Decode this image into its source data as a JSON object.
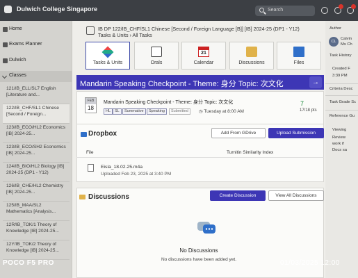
{
  "app": {
    "title": "Dulwich College Singapore"
  },
  "search": {
    "placeholder": "Search"
  },
  "sidebar": {
    "nav": [
      {
        "label": "Home",
        "icon": "home-icon"
      },
      {
        "label": "Exams Planner",
        "icon": "calendar-icon"
      },
      {
        "label": "Dulwich",
        "icon": "building-icon"
      }
    ],
    "classes_label": "Classes",
    "classes": [
      {
        "label": "121/IB_ELL/SL7 English [Literature and..."
      },
      {
        "label": "122/IB_CHF/SL1 Chinese [Second / Foreign..."
      },
      {
        "label": "123/IB_ECO/HL2 Economics [IB] 2024-25..."
      },
      {
        "label": "123/IB_ECO/SH2 Economics [IB] 2024-25..."
      },
      {
        "label": "124/IB_BIO/HL2 Biology [IB] 2024-25 (DP1 - Y12)"
      },
      {
        "label": "126/IB_CHE/HL2 Chemistry [IB] 2024-25..."
      },
      {
        "label": "125/IB_MAA/SL2 Mathematics [Analysis..."
      },
      {
        "label": "12R/IB_TOK/1 Theory of Knowledge [IB] 2024-25..."
      },
      {
        "label": "12Y/IB_TOK/2 Theory of Knowledge [IB] 2024-25..."
      }
    ]
  },
  "breadcrumb": {
    "course": "IB DP 122/IB_CHF/SL1 Chinese [Second / Foreign Language [B]] [IB] 2024-25 (DP1 - Y12)",
    "trail": "Tasks & Units  ›  All Tasks"
  },
  "tabs": [
    {
      "label": "Tasks & Units",
      "icon": "tasks-icon",
      "selected": true
    },
    {
      "label": "Orals",
      "icon": "orals-icon",
      "selected": false
    },
    {
      "label": "Calendar",
      "icon": "calendar-icon",
      "selected": false
    },
    {
      "label": "Discussions",
      "icon": "discussions-icon",
      "selected": false
    },
    {
      "label": "Files",
      "icon": "files-icon",
      "selected": false
    }
  ],
  "calendar_tab_day": "21",
  "task": {
    "banner_title": "Mandarin Speaking Checkpoint - Theme: 身分 Topic: 次文化",
    "banner_arrow": "→",
    "date_month": "FEB",
    "date_day": "18",
    "title": "Mandarin Speaking Checkpoint - Theme: 身分 Topic: 次文化",
    "tags": [
      "HL",
      "SL",
      "Summative",
      "Speaking",
      "Submitted"
    ],
    "due": "Tuesday at 8:00 AM",
    "points": "7",
    "points_total": "17/18 pts"
  },
  "dropbox": {
    "heading": "Dropbox",
    "add_gdrive": "Add From GDrive",
    "upload": "Upload Submission",
    "col_file": "File",
    "col_turnitin": "Turnitin Similarity Index",
    "file_name": "Eisla_18.02.25.m4a",
    "file_uploaded": "Uploaded Feb 23, 2025 at 3:40 PM"
  },
  "discussions": {
    "heading": "Discussions",
    "create": "Create Discussion",
    "view_all": "View All Discussions",
    "empty_title": "No Discussions",
    "empty_sub": "No discussions have been added yet."
  },
  "right_panel": {
    "author_label": "Author",
    "author_initials": "CL",
    "author_name": "Calvin",
    "author_sub": "Ms Ch",
    "history_label": "Task History",
    "history_item": "Created F",
    "history_time": "3:39 PM",
    "criteria": "Criteria Desc",
    "grade_scale": "Task Grade Sc",
    "reference": "Reference Gu",
    "viewing": "Viewing",
    "review1": "Review",
    "review2": "work if",
    "review3": "Docs sa"
  },
  "watermark": {
    "left": "POCO F5 PRO",
    "right": "01/03/2025  12:00"
  },
  "colors": {
    "accent": "#3d36b5",
    "topbar": "#3c3f44",
    "points": "#1a8a3a"
  }
}
